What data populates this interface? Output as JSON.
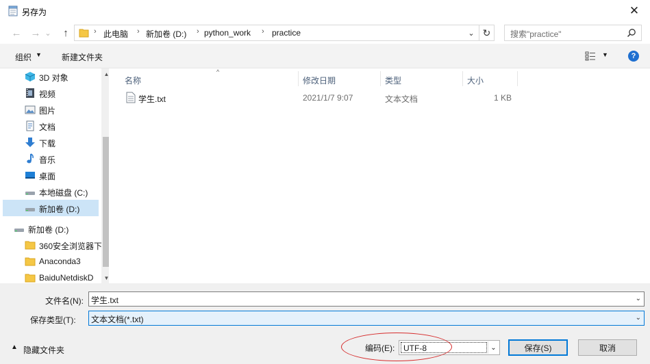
{
  "window": {
    "title": "另存为",
    "close_glyph": "✕"
  },
  "nav": {
    "back_glyph": "←",
    "forward_glyph": "→",
    "recent_glyph": "⌄",
    "up_glyph": "↑"
  },
  "address": {
    "crumbs": [
      "此电脑",
      "新加卷 (D:)",
      "python_work",
      "practice"
    ],
    "separator": "›",
    "dropdown_glyph": "⌄",
    "refresh_glyph": "↻"
  },
  "search": {
    "placeholder": "搜索\"practice\""
  },
  "toolbar": {
    "organize": "组织",
    "new_folder": "新建文件夹",
    "help": "?"
  },
  "sidebar": {
    "items": [
      {
        "label": "3D 对象",
        "icon": "3d-objects-icon"
      },
      {
        "label": "视频",
        "icon": "video-icon"
      },
      {
        "label": "图片",
        "icon": "pictures-icon"
      },
      {
        "label": "文档",
        "icon": "documents-icon"
      },
      {
        "label": "下载",
        "icon": "download-icon"
      },
      {
        "label": "音乐",
        "icon": "music-icon"
      },
      {
        "label": "桌面",
        "icon": "desktop-icon"
      },
      {
        "label": "本地磁盘 (C:)",
        "icon": "drive-icon"
      },
      {
        "label": "新加卷 (D:)",
        "icon": "drive-icon",
        "selected": true
      },
      {
        "label": "新加卷 (D:)",
        "icon": "drive-icon"
      },
      {
        "label": "360安全浏览器下",
        "icon": "folder-icon"
      },
      {
        "label": "Anaconda3",
        "icon": "folder-icon"
      },
      {
        "label": "BaiduNetdiskD",
        "icon": "folder-icon"
      }
    ]
  },
  "filelist": {
    "columns": [
      "名称",
      "修改日期",
      "类型",
      "大小"
    ],
    "rows": [
      {
        "name": "学生.txt",
        "modified": "2021/1/7 9:07",
        "type": "文本文档",
        "size": "1 KB"
      }
    ]
  },
  "form": {
    "filename_label": "文件名(N):",
    "filename_value": "学生.txt",
    "filetype_label": "保存类型(T):",
    "filetype_value": "文本文档(*.txt)",
    "hide_folders": "隐藏文件夹",
    "encoding_label": "编码(E):",
    "encoding_value": "UTF-8",
    "save": "保存(S)",
    "cancel": "取消"
  },
  "colors": {
    "accent": "#0078d7",
    "selection": "#cce4f7",
    "annotation": "#d62b2b",
    "folder": "#f5c745"
  }
}
